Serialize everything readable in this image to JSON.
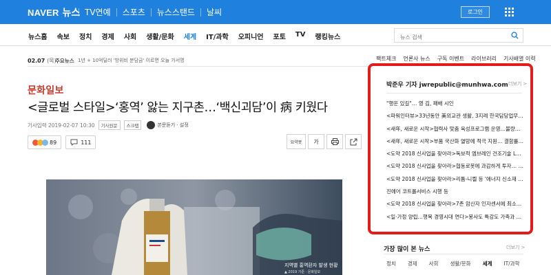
{
  "header": {
    "logo_naver": "NAVER",
    "logo_news": "뉴스",
    "services": [
      "TV연예",
      "스포츠",
      "뉴스스탠드",
      "날씨"
    ],
    "login_label": "로그인",
    "accent_color": "#1f81dd"
  },
  "nav": {
    "items": [
      {
        "label": "뉴스홈"
      },
      {
        "label": "속보"
      },
      {
        "label": "정치"
      },
      {
        "label": "경제"
      },
      {
        "label": "사회"
      },
      {
        "label": "생활/문화"
      },
      {
        "label": "세계",
        "active": true
      },
      {
        "label": "IT/과학"
      },
      {
        "label": "오피니언"
      },
      {
        "label": "포토"
      },
      {
        "label": "TV"
      },
      {
        "label": "랭킹뉴스"
      }
    ],
    "search_placeholder": "뉴스 검색"
  },
  "subbar": {
    "date": "02.07",
    "weekday": "(목)",
    "main_label": "주요뉴스",
    "headline": "1년 + 10억딜러 '방위비 분담금' 이르면 오늘 가서명",
    "right_links": [
      "팩트체크",
      "언론사 뉴스",
      "구독 이벤트",
      "라이브러리",
      "기사배열 이력"
    ]
  },
  "article": {
    "press": "문화일보",
    "title": "<글로벌 스타일>‘홍역’ 앓는 지구촌…‘백신괴담’이 病 키웠다",
    "input_date": "기사입력 2019-02-07 10:30",
    "tags": [
      "기사원문",
      "스크랩"
    ],
    "original_label": "본문듣기 · 설정",
    "reactions": {
      "emotion_count": "89",
      "comment_count": "111"
    },
    "tools": {
      "summary": "요약봇",
      "font": "가"
    },
    "photo_caption": "지역별 홍역환자 발생 현황",
    "photo_caption_sub": "▲ 2019 기준 · 문화일보"
  },
  "reporter_panel": {
    "title": "박준우 기자 jwrepublic@munhwa.com",
    "more": "더보기 >",
    "border_color": "#e21b1b",
    "articles": [
      "\"행운 있길\"… 영 김, 패배 시인",
      "<파워인터뷰>33년동안 美외교관 생활, 3지례 한국담당업무 맡…",
      "<새年, 새로운 시작>협력사 맞춤 육성프로그램 운영…불량률 1…",
      "<새年, 새로운 시작>부품 국산화 열망에 적극 지원… 결함률 0…",
      "<도약 2018 신사업을 찾아라>독보적 엠브레인 건조기술 LNG…",
      "<도약 2018 신사업을 찾아라>협동로봇에 과감하게 투자… 산…",
      "<도약 2018 신사업을 찾아라>리튬-니켈 등 '에너지 신소재 사업…",
      "진에어 코트롤서비스 시행 등",
      "<도약 2018 신사업을 찾아라>7존 암산자 인자센서에 최소한…",
      "<일·가정 양립…행복 경영시대 연다>봉사도 특강도 가족과 함…"
    ]
  },
  "popular": {
    "title": "가장 많이 본 뉴스",
    "more": "더보기 >",
    "tabs": [
      {
        "label": "정치"
      },
      {
        "label": "경제"
      },
      {
        "label": "사회"
      },
      {
        "label": "생활/문화"
      },
      {
        "label": "세계",
        "active": true
      },
      {
        "label": "IT/과학"
      }
    ]
  }
}
